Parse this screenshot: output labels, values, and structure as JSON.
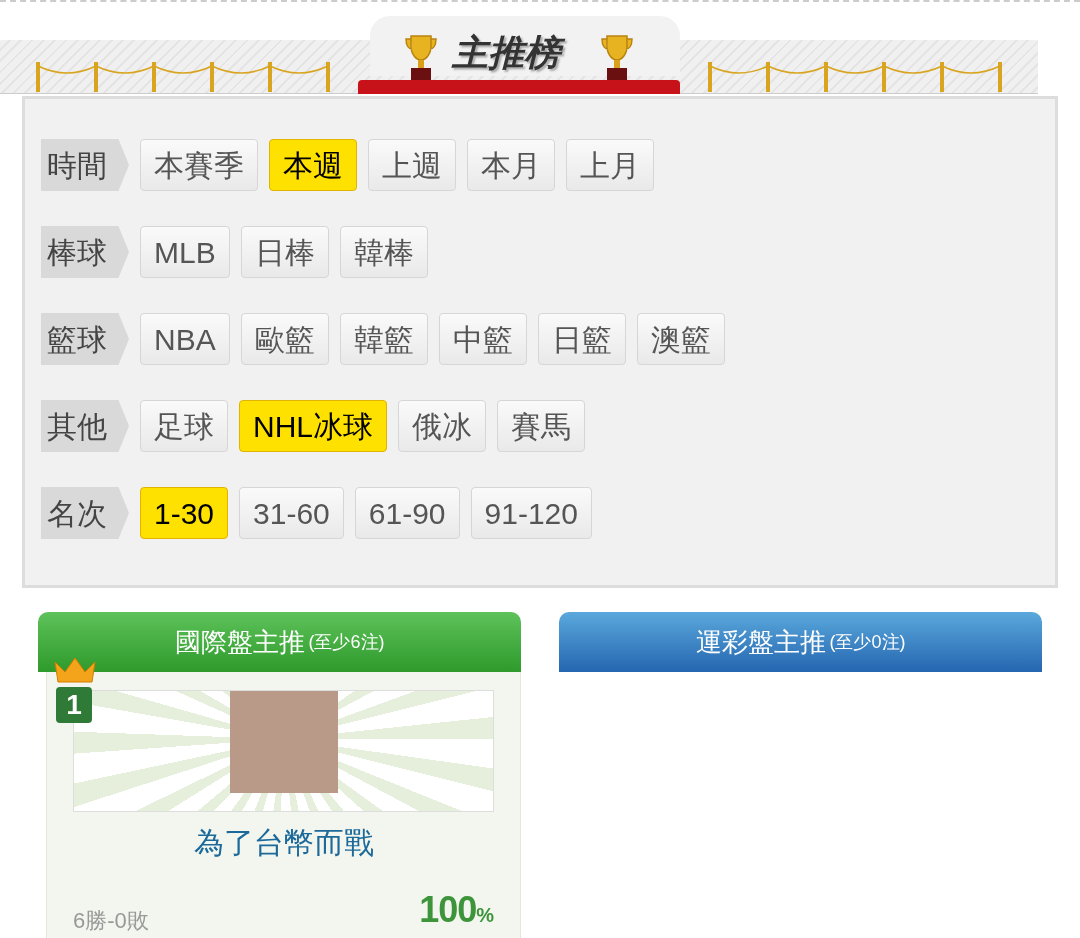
{
  "header": {
    "title": "主推榜"
  },
  "filters": [
    {
      "label": "時間",
      "options": [
        {
          "text": "本賽季",
          "selected": false
        },
        {
          "text": "本週",
          "selected": true
        },
        {
          "text": "上週",
          "selected": false
        },
        {
          "text": "本月",
          "selected": false
        },
        {
          "text": "上月",
          "selected": false
        }
      ]
    },
    {
      "label": "棒球",
      "options": [
        {
          "text": "MLB",
          "selected": false
        },
        {
          "text": "日棒",
          "selected": false
        },
        {
          "text": "韓棒",
          "selected": false
        }
      ]
    },
    {
      "label": "籃球",
      "options": [
        {
          "text": "NBA",
          "selected": false
        },
        {
          "text": "歐籃",
          "selected": false
        },
        {
          "text": "韓籃",
          "selected": false
        },
        {
          "text": "中籃",
          "selected": false
        },
        {
          "text": "日籃",
          "selected": false
        },
        {
          "text": "澳籃",
          "selected": false
        }
      ]
    },
    {
      "label": "其他",
      "options": [
        {
          "text": "足球",
          "selected": false
        },
        {
          "text": "NHL冰球",
          "selected": true
        },
        {
          "text": "俄冰",
          "selected": false
        },
        {
          "text": "賽馬",
          "selected": false
        }
      ]
    },
    {
      "label": "名次",
      "options": [
        {
          "text": "1-30",
          "selected": true
        },
        {
          "text": "31-60",
          "selected": false
        },
        {
          "text": "61-90",
          "selected": false
        },
        {
          "text": "91-120",
          "selected": false
        }
      ]
    }
  ],
  "boards": [
    {
      "kind": "green",
      "title": "國際盤主推",
      "note": "(至少6注)",
      "entries": [
        {
          "rank": "1",
          "name": "為了台幣而戰",
          "record": "6勝-0敗",
          "rate": "100",
          "unit": "%"
        }
      ]
    },
    {
      "kind": "blue",
      "title": "運彩盤主推",
      "note": "(至少0注)"
    }
  ]
}
